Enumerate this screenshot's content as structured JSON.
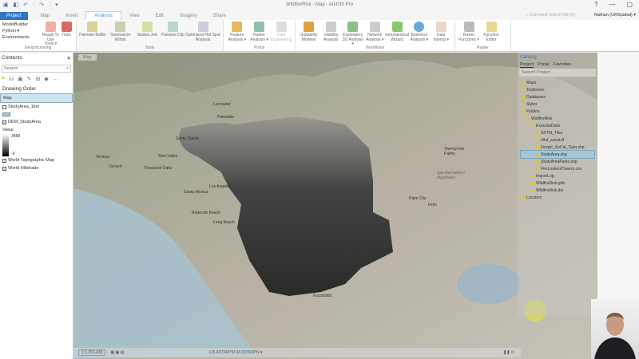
{
  "window": {
    "title": "WildfireRisk - Map - ArcGIS Pro",
    "help": "?",
    "minimize": "—",
    "maximize": "▢",
    "quick_access": "▣ ◧ ↶ · ↷ · ▾"
  },
  "tabs": [
    "Project",
    "Map",
    "Insert",
    "Analysis",
    "View",
    "Edit",
    "Imagery",
    "Share"
  ],
  "command_search": "Command Search (Alt+Q)",
  "user": "Nathan (URSpatial) ▾",
  "ribbon": {
    "geoprocessing": {
      "label": "Geoprocessing",
      "items": [
        "ModelBuilder",
        "Python ▾",
        "Environments"
      ],
      "buttons": [
        "Ready To Use Tools ▾",
        "Tools"
      ]
    },
    "tools": {
      "label": "Tools",
      "buttons": [
        "Pairwise Buffer",
        "Summarize Within",
        "Spatial Join",
        "Pairwise Clip",
        "Optimized Hot Spot Analysis"
      ]
    },
    "portal": {
      "label": "Portal",
      "buttons": [
        "Feature Analysis ▾",
        "Raster Analysis ▾",
        "Data Engineering"
      ]
    },
    "workflows": {
      "label": "Workflows",
      "buttons": [
        "Suitability Modeler",
        "Visibility Analysis",
        "Exploratory 3D Analysis ▾",
        "Network Analysis ▾",
        "Geostatistical Wizard",
        "Business Analysis ▾",
        "Data Interop ▾"
      ]
    },
    "raster": {
      "label": "Raster",
      "buttons": [
        "Raster Functions ▾",
        "Function Editor"
      ]
    }
  },
  "contents": {
    "title": "Contents",
    "search": "Search",
    "drawing_order": "Drawing Order",
    "map": "Map",
    "layers": [
      {
        "name": "StudyArea_1km",
        "checked": false
      },
      {
        "name": "DEM_StudyArea",
        "checked": true
      },
      {
        "name": "World Topographic Map",
        "checked": true
      },
      {
        "name": "World Hillshade",
        "checked": true
      }
    ],
    "value_label": "Value",
    "value_max": "3488",
    "value_min": "-9"
  },
  "map": {
    "tab": "Map",
    "labels": [
      "Lancaster",
      "Palmdale",
      "Santa Clarita",
      "Ventura",
      "Oxnard",
      "Simi Valley",
      "Thousand Oaks",
      "Los Angeles",
      "Santa Monica",
      "Redondo Beach",
      "Long Beach",
      "Twentynine Palms",
      "San Bernardino Mountains",
      "Palm City",
      "Indio",
      "Escondido"
    ],
    "scale": "1:1,301,433",
    "coords": "115.437340°W 33.023509°N ▾"
  },
  "catalog": {
    "title": "Catalog",
    "tabs": [
      "Project",
      "Portal",
      "Favorites"
    ],
    "search": "Search Project",
    "items": [
      {
        "name": "Maps",
        "level": 0,
        "selected": false
      },
      {
        "name": "Toolboxes",
        "level": 0,
        "selected": false
      },
      {
        "name": "Databases",
        "level": 0,
        "selected": false
      },
      {
        "name": "Styles",
        "level": 0,
        "selected": false
      },
      {
        "name": "Folders",
        "level": 0,
        "selected": false
      },
      {
        "name": "WildfireRisk",
        "level": 1,
        "selected": false
      },
      {
        "name": "ExerciseData",
        "level": 2,
        "selected": false
      },
      {
        "name": "SRTM_Tiles",
        "level": 3,
        "selected": false
      },
      {
        "name": "elhd_socal.tif",
        "level": 3,
        "selected": false
      },
      {
        "name": "Fireplc_SoCal_Tiger.shp",
        "level": 3,
        "selected": false
      },
      {
        "name": "StudyArea.shp",
        "level": 3,
        "selected": true
      },
      {
        "name": "StudyAreaParks.shp",
        "level": 3,
        "selected": false
      },
      {
        "name": "FireLookoutTowers.csv",
        "level": 3,
        "selected": false
      },
      {
        "name": "ImportLog",
        "level": 2,
        "selected": false
      },
      {
        "name": "WildfireRisk.gdb",
        "level": 2,
        "selected": false
      },
      {
        "name": "WildfireRisk.tbx",
        "level": 2,
        "selected": false
      },
      {
        "name": "Locators",
        "level": 0,
        "selected": false
      }
    ]
  }
}
